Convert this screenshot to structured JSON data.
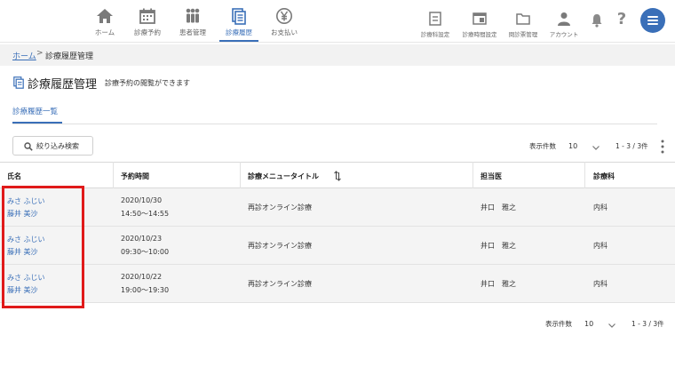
{
  "nav": {
    "items": [
      {
        "label": "ホーム",
        "icon": "home-icon"
      },
      {
        "label": "診療予約",
        "icon": "calendar-icon"
      },
      {
        "label": "患者管理",
        "icon": "patients-icon"
      },
      {
        "label": "診療履歴",
        "icon": "history-icon",
        "active": true
      },
      {
        "label": "お支払い",
        "icon": "yen-icon"
      }
    ],
    "tools": [
      {
        "label": "診療科設定",
        "icon": "department-settings-icon"
      },
      {
        "label": "診療時間設定",
        "icon": "hours-settings-icon"
      },
      {
        "label": "問診票管理",
        "icon": "folder-icon"
      },
      {
        "label": "アカウント",
        "icon": "account-icon"
      }
    ],
    "help_label": "?",
    "accent_color": "#3a6fb8"
  },
  "breadcrumb": {
    "home": "ホーム",
    "separator": ">",
    "current": "診療履歴管理"
  },
  "page": {
    "title": "診療履歴管理",
    "subtitle": "診療予約の閲覧ができます",
    "tab": "診療履歴一覧"
  },
  "filter": {
    "button_label": "絞り込み検索"
  },
  "pagination": {
    "per_page_label": "表示件数",
    "per_page_value": "10",
    "range": "1 - 3 / 3件"
  },
  "table": {
    "headers": [
      "氏名",
      "予約時間",
      "診療メニュータイトル",
      "担当医",
      "診療科"
    ],
    "rows": [
      {
        "kana": "みさ ふじい",
        "name": "藤井 美沙",
        "date": "2020/10/30",
        "time": "14:50〜14:55",
        "menu": "再診オンライン診療",
        "doctor": "井口　雅之",
        "dept": "内科"
      },
      {
        "kana": "みさ ふじい",
        "name": "藤井 美沙",
        "date": "2020/10/23",
        "time": "09:30〜10:00",
        "menu": "再診オンライン診療",
        "doctor": "井口　雅之",
        "dept": "内科"
      },
      {
        "kana": "みさ ふじい",
        "name": "藤井 美沙",
        "date": "2020/10/22",
        "time": "19:00〜19:30",
        "menu": "再診オンライン診療",
        "doctor": "井口　雅之",
        "dept": "内科"
      }
    ]
  },
  "highlight_color": "#e01a1a"
}
